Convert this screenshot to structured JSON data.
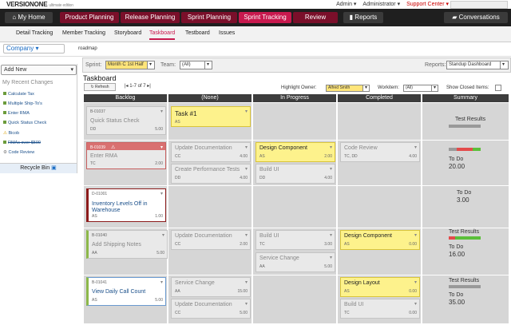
{
  "topbar": {
    "logo": "VERSIONONE",
    "edition": "ultimate edition",
    "admin": "Admin ▾",
    "administrator": "Administrator ▾",
    "support": "Support Center ▾"
  },
  "nav": {
    "home": "My Home",
    "product": "Product Planning",
    "release": "Release Planning",
    "sprint": "Sprint Planning",
    "tracking": "Sprint Tracking",
    "review": "Review",
    "reports": "Reports",
    "conversations": "Conversations"
  },
  "subnav": [
    "Detail Tracking",
    "Member Tracking",
    "Storyboard",
    "Taskboard",
    "Testboard",
    "Issues"
  ],
  "project": {
    "name": "Company",
    "roadmap": "roadmap"
  },
  "left": {
    "add_new": "Add New",
    "recent_title": "My Recent Changes",
    "recent": [
      "Calculate Tax",
      "Multiple Ship-To's",
      "Enter RMA",
      "Quick Status Check",
      "Bicob",
      "RMAs over $500",
      "Code Review"
    ],
    "recycle": "Recycle Bin"
  },
  "filters": {
    "sprint_label": "Sprint:",
    "sprint": "Month C 1st Half",
    "team_label": "Team:",
    "team": "(All)",
    "reports_label": "Reports:",
    "reports": "Standup Dashboard"
  },
  "board": {
    "title": "Taskboard",
    "refresh": "Refresh",
    "pager": "1-7 of 7",
    "highlight_label": "Highlight Owner:",
    "highlight": "Alfred Smith",
    "workitem_label": "Workitem:",
    "workitem": "(All)",
    "closed_label": "Show Closed Items:",
    "columns": [
      "Backlog",
      "(None)",
      "In Progress",
      "Completed",
      "Summary"
    ]
  },
  "cards": {
    "b1": {
      "id": "B-01037",
      "title": "Quick Status Check",
      "owner": "DD",
      "est": "5.00"
    },
    "task1": {
      "title": "Task #1",
      "owner": "AS"
    },
    "b2": {
      "id": "B-01039",
      "title": "Enter RMA",
      "owner": "TC",
      "est": "2.00"
    },
    "upd1": {
      "title": "Update Documentation",
      "owner": "CC",
      "est": "4.00"
    },
    "perf": {
      "title": "Create Performance Tests",
      "owner": "DD",
      "est": "4.00"
    },
    "design1": {
      "title": "Design Component",
      "owner": "AS",
      "est": "2.00"
    },
    "build1": {
      "title": "Build UI",
      "owner": "DD",
      "est": "4.00"
    },
    "code": {
      "title": "Code Review",
      "owner": "TC, DD",
      "est": "4.00"
    },
    "d1": {
      "id": "D-01001",
      "title": "Inventory Levels Off in Warehouse",
      "owner": "AS",
      "est": "1.00"
    },
    "b3": {
      "id": "B-01040",
      "title": "Add Shipping Notes",
      "owner": "AA",
      "est": "5.00"
    },
    "upd2": {
      "title": "Update Documentation",
      "owner": "CC",
      "est": "2.00"
    },
    "build2": {
      "title": "Build UI",
      "owner": "TC",
      "est": "3.00"
    },
    "svc1": {
      "title": "Service Change",
      "owner": "AA",
      "est": "5.00"
    },
    "design2": {
      "title": "Design Component",
      "owner": "AS",
      "est": "0.00"
    },
    "b4": {
      "id": "B-01041",
      "title": "View Daily Call Count",
      "owner": "AS",
      "est": "5.00"
    },
    "svc2": {
      "title": "Service Change",
      "owner": "AA",
      "est": "15.00"
    },
    "upd3": {
      "title": "Update Documentation",
      "owner": "CC",
      "est": "5.00"
    },
    "design3": {
      "title": "Design Layout",
      "owner": "AS",
      "est": "0.00"
    },
    "build3": {
      "title": "Build UI",
      "owner": "TC",
      "est": "0.00"
    }
  },
  "summary": {
    "r1": {
      "test": "Test Results",
      "todo": "To Do",
      "val": "20.00"
    },
    "r2": {
      "todo": "To Do",
      "val": "3.00"
    },
    "r3": {
      "test": "Test Results",
      "todo": "To Do",
      "val": "16.00"
    },
    "r4": {
      "test": "Test Results",
      "todo": "To Do",
      "val": "35.00"
    }
  }
}
